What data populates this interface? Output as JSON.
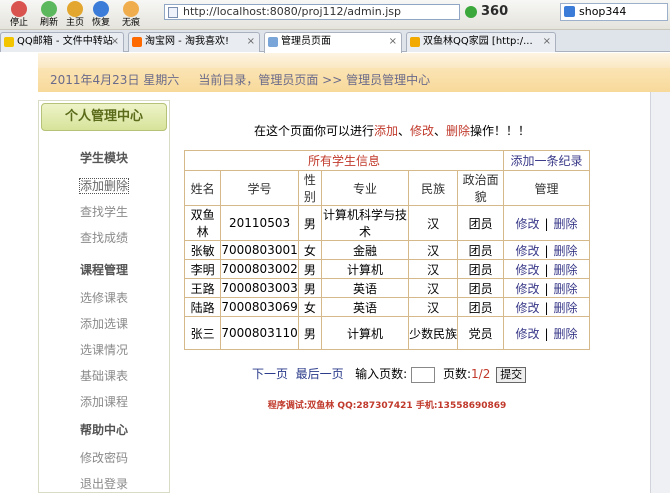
{
  "browser": {
    "toolbar": [
      {
        "label": "停止",
        "icon": "stop-icon",
        "color": "#d9534f"
      },
      {
        "label": "刷新",
        "icon": "refresh-icon",
        "color": "#5cb85c"
      },
      {
        "label": "主页",
        "icon": "home-icon",
        "color": "#e3a72f"
      },
      {
        "label": "恢复",
        "icon": "restore-icon",
        "color": "#3b7cd9"
      },
      {
        "label": "无痕",
        "icon": "incognito-icon",
        "color": "#f0ad4e"
      }
    ],
    "address": "http://localhost:8080/proj112/admin.jsp",
    "brand": "360",
    "search": "shop344",
    "tabs": [
      {
        "label": "QQ邮箱 - 文件中转站",
        "icon_color": "#f2c500"
      },
      {
        "label": "淘宝网 - 淘我喜欢!",
        "icon_color": "#ff6a00"
      },
      {
        "label": "管理员页面",
        "icon_color": "#7aa5d8"
      },
      {
        "label": "双鱼林QQ家园 [http:/...",
        "icon_color": "#f2a900"
      }
    ]
  },
  "page": {
    "date": "2011年4月23日  星期六",
    "breadcrumb": "当前目录，管理员页面 >> 管理员管理中心"
  },
  "sidebar": {
    "title": "个人管理中心",
    "groups": [
      {
        "label": "学生模块",
        "items": [
          "添加删除",
          "查找学生",
          "查找成绩"
        ]
      },
      {
        "label": "课程管理",
        "items": [
          "选修课表",
          "添加选课",
          "选课情况",
          "基础课表",
          "添加课程"
        ]
      },
      {
        "label": "帮助中心",
        "items": [
          "修改密码",
          "退出登录"
        ]
      }
    ]
  },
  "main": {
    "intro": {
      "prefix": "在这个页面你可以进行",
      "a1": "添加",
      "sep1": "、",
      "a2": "修改",
      "sep2": "、",
      "a3": "删除",
      "suffix": "操作！！！"
    },
    "table": {
      "title": "所有学生信息",
      "add_link": "添加一条纪录",
      "headers": [
        "姓名",
        "学号",
        "性别",
        "专业",
        "民族",
        "政治面貌",
        "管理"
      ],
      "rows": [
        {
          "name": "双鱼林",
          "id": "20110503",
          "sex": "男",
          "major": "计算机科学与技术",
          "nation": "汉",
          "party": "团员"
        },
        {
          "name": "张敏",
          "id": "7000803001",
          "sex": "女",
          "major": "金融",
          "nation": "汉",
          "party": "团员"
        },
        {
          "name": "李明",
          "id": "7000803002",
          "sex": "男",
          "major": "计算机",
          "nation": "汉",
          "party": "团员"
        },
        {
          "name": "王路",
          "id": "7000803003",
          "sex": "男",
          "major": "英语",
          "nation": "汉",
          "party": "团员"
        },
        {
          "name": "陆路",
          "id": "7000803069",
          "sex": "女",
          "major": "英语",
          "nation": "汉",
          "party": "团员"
        },
        {
          "name": "张三",
          "id": "7000803110",
          "sex": "男",
          "major": "计算机",
          "nation": "少数民族",
          "party": "党员"
        }
      ],
      "edit_label": "修改",
      "sep": "|",
      "delete_label": "删除"
    },
    "pager": {
      "next": "下一页",
      "last": "最后一页",
      "input_label": "输入页数:",
      "page_label": "页数:",
      "page_value": "1/2",
      "submit": "提交"
    },
    "footer": "程序调试:双鱼林 QQ:287307421 手机:13558690869"
  }
}
